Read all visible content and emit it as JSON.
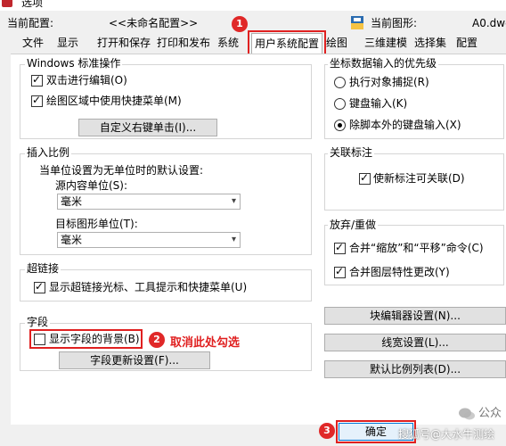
{
  "window": {
    "title": "选项"
  },
  "info": {
    "current_profile_label": "当前配置:",
    "current_profile_value": "<<未命名配置>>",
    "current_drawing_label": "当前图形:",
    "current_drawing_value": "A0.dwg"
  },
  "tabs": [
    "文件",
    "显示",
    "打开和保存",
    "打印和发布",
    "系统",
    "用户系统配置",
    "绘图",
    "三维建模",
    "选择集",
    "配置"
  ],
  "windows_ops": {
    "title": "Windows 标准操作",
    "dblclick_label": "双击进行编辑(O)",
    "dblclick_checked": true,
    "shortcut_label": "绘图区域中使用快捷菜单(M)",
    "shortcut_checked": true,
    "custom_button": "自定义右键单击(I)..."
  },
  "insert_scale": {
    "title": "插入比例",
    "desc": "当单位设置为无单位时的默认设置:",
    "source_label": "源内容单位(S):",
    "source_value": "毫米",
    "target_label": "目标图形单位(T):",
    "target_value": "毫米"
  },
  "hyperlink": {
    "title": "超链接",
    "label": "显示超链接光标、工具提示和快捷菜单(U)",
    "checked": true
  },
  "fields": {
    "title": "字段",
    "bg_label": "显示字段的背景(B)",
    "bg_checked": false,
    "update_button": "字段更新设置(F)..."
  },
  "coord_input": {
    "title": "坐标数据输入的优先级",
    "options": [
      "执行对象捕捉(R)",
      "键盘输入(K)",
      "除脚本外的键盘输入(X)"
    ],
    "selected_index": 2
  },
  "assoc_dim": {
    "title": "关联标注",
    "label": "使新标注可关联(D)",
    "checked": true
  },
  "undo_redo": {
    "title": "放弃/重做",
    "zoom_pan_label": "合并“缩放”和“平移”命令(C)",
    "zoom_pan_checked": true,
    "layer_label": "合并图层特性更改(Y)",
    "layer_checked": true
  },
  "right_buttons": [
    "块编辑器设置(N)...",
    "线宽设置(L)...",
    "默认比例列表(D)..."
  ],
  "footer": {
    "ok_button": "确定"
  },
  "annotations": {
    "step1": "1",
    "step2": "2",
    "step2_text": "取消此处勾选",
    "step3": "3"
  },
  "watermark": {
    "line1": "公众",
    "line2": "搜狐号@大水牛测绘"
  },
  "colors": {
    "annotation_red": "#e02020",
    "ok_highlight": "#0078d7"
  }
}
